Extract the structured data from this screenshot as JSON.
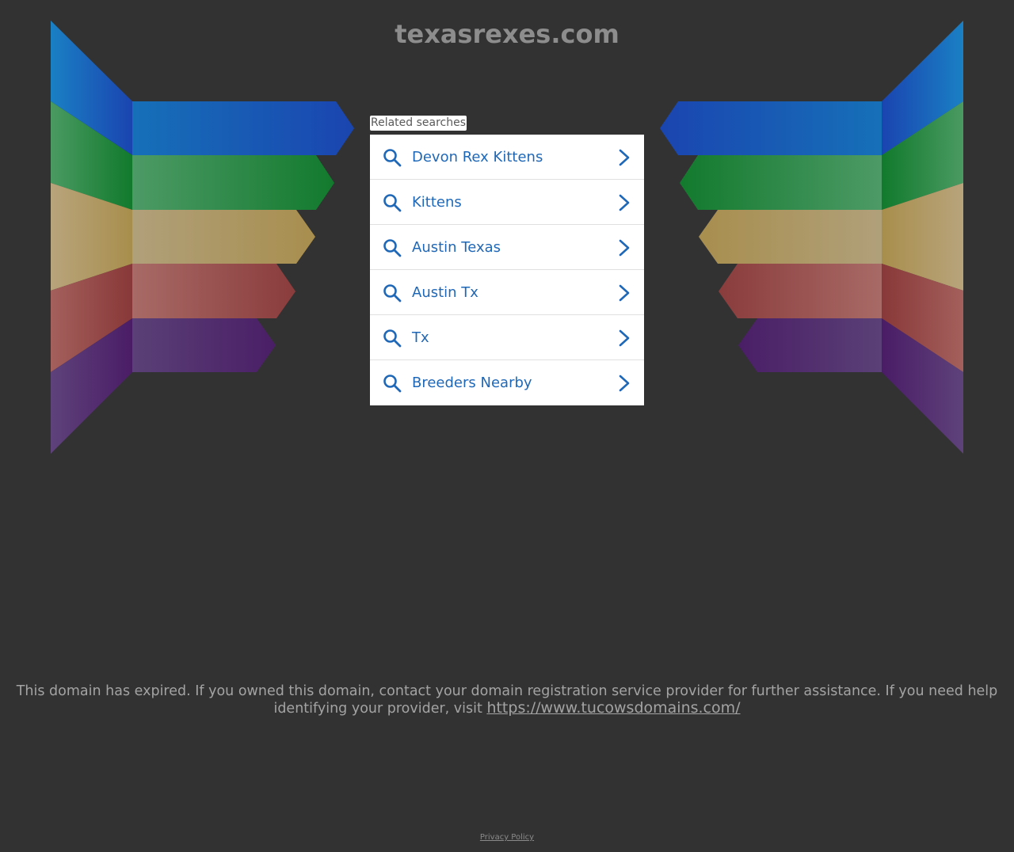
{
  "header": {
    "domain_title": "texasrexes.com"
  },
  "related": {
    "label": "Related searches",
    "items": [
      {
        "label": "Devon Rex Kittens"
      },
      {
        "label": "Kittens"
      },
      {
        "label": "Austin Texas"
      },
      {
        "label": "Austin Tx"
      },
      {
        "label": "Tx"
      },
      {
        "label": "Breeders Nearby"
      }
    ]
  },
  "footer": {
    "expiry_message": "This domain has expired. If you owned this domain, contact your domain registration service provider for further assistance. If you need help identifying your provider, visit",
    "provider_link": "https://www.tucowsdomains.com/",
    "privacy_policy": "Privacy Policy"
  },
  "colors": {
    "background": "#323232",
    "link_blue": "#1f68b8",
    "band_blue": "#1a4fb3",
    "band_green": "#1f7a33",
    "band_tan": "#a89358",
    "band_red": "#8f4444",
    "band_purple": "#4a2766"
  },
  "icons": {
    "search": "search-icon",
    "chevron": "chevron-right-icon"
  }
}
